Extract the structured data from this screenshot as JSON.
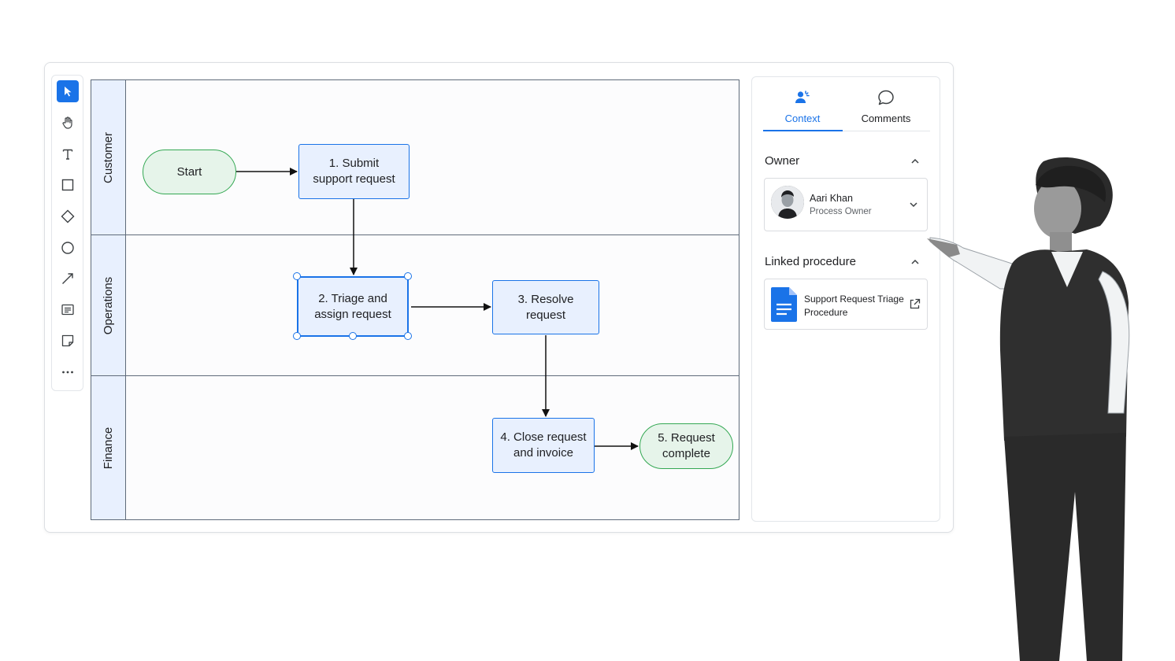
{
  "toolbar": {
    "tools": [
      {
        "name": "select-tool",
        "icon": "cursor-arrow-icon",
        "active": true
      },
      {
        "name": "hand-tool",
        "icon": "hand-icon"
      },
      {
        "name": "text-tool",
        "icon": "text-icon"
      },
      {
        "name": "rectangle-tool",
        "icon": "square-icon"
      },
      {
        "name": "diamond-tool",
        "icon": "diamond-icon"
      },
      {
        "name": "circle-tool",
        "icon": "circle-icon"
      },
      {
        "name": "line-tool",
        "icon": "arrow-line-icon"
      },
      {
        "name": "note-tool",
        "icon": "note-icon"
      },
      {
        "name": "sticky-tool",
        "icon": "sticky-note-icon"
      },
      {
        "name": "more-tool",
        "icon": "more-dots-icon"
      }
    ]
  },
  "lanes": [
    "Customer",
    "Operations",
    "Finance"
  ],
  "nodes": {
    "start": "Start",
    "step1": "1. Submit\nsupport request",
    "step2": "2. Triage and\nassign request",
    "step3": "3. Resolve\nrequest",
    "step4": "4. Close request\nand invoice",
    "step5": "5. Request\ncomplete"
  },
  "panel": {
    "tabs": [
      {
        "label": "Context",
        "active": true,
        "icon": "person-sparkle-icon"
      },
      {
        "label": "Comments",
        "active": false,
        "icon": "comment-icon"
      }
    ],
    "owner_section": "Owner",
    "owner": {
      "name": "Aari Khan",
      "role": "Process Owner"
    },
    "procedure_section": "Linked procedure",
    "procedure": {
      "title": "Support Request Triage Procedure",
      "icon": "google-doc-icon"
    }
  },
  "colors": {
    "accent": "#1a73e8",
    "process_fill": "#e8f0fe",
    "terminal_fill": "#e6f4ea",
    "terminal_stroke": "#34a853",
    "lane_header": "#e8f0fe"
  }
}
